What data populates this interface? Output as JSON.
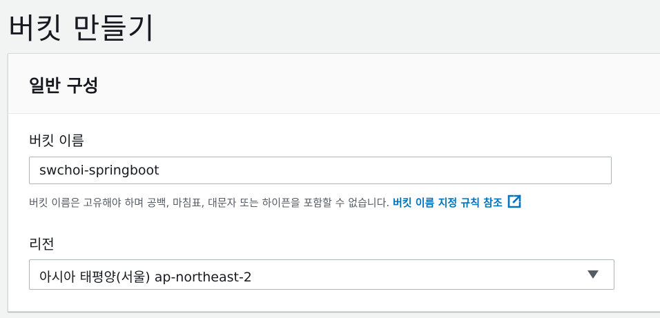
{
  "page": {
    "title": "버킷 만들기"
  },
  "general_config": {
    "header_title": "일반 구성",
    "bucket_name": {
      "label": "버킷 이름",
      "value": "swchoi-springboot",
      "hint": "버킷 이름은 고유해야 하며 공백, 마침표, 대문자 또는 하이픈을 포함할 수 없습니다. ",
      "hint_link": "버킷 이름 지정 규칙 참조",
      "hint_link_icon": "external-link-icon"
    },
    "region": {
      "label": "리전",
      "selected": "아시아 태평양(서울) ap-northeast-2",
      "icon": "caret-down-icon"
    }
  },
  "colors": {
    "link": "#0073bb",
    "page_background": "#f2f3f3",
    "panel_header_background": "#fafafa",
    "border": "#aab7b8"
  }
}
